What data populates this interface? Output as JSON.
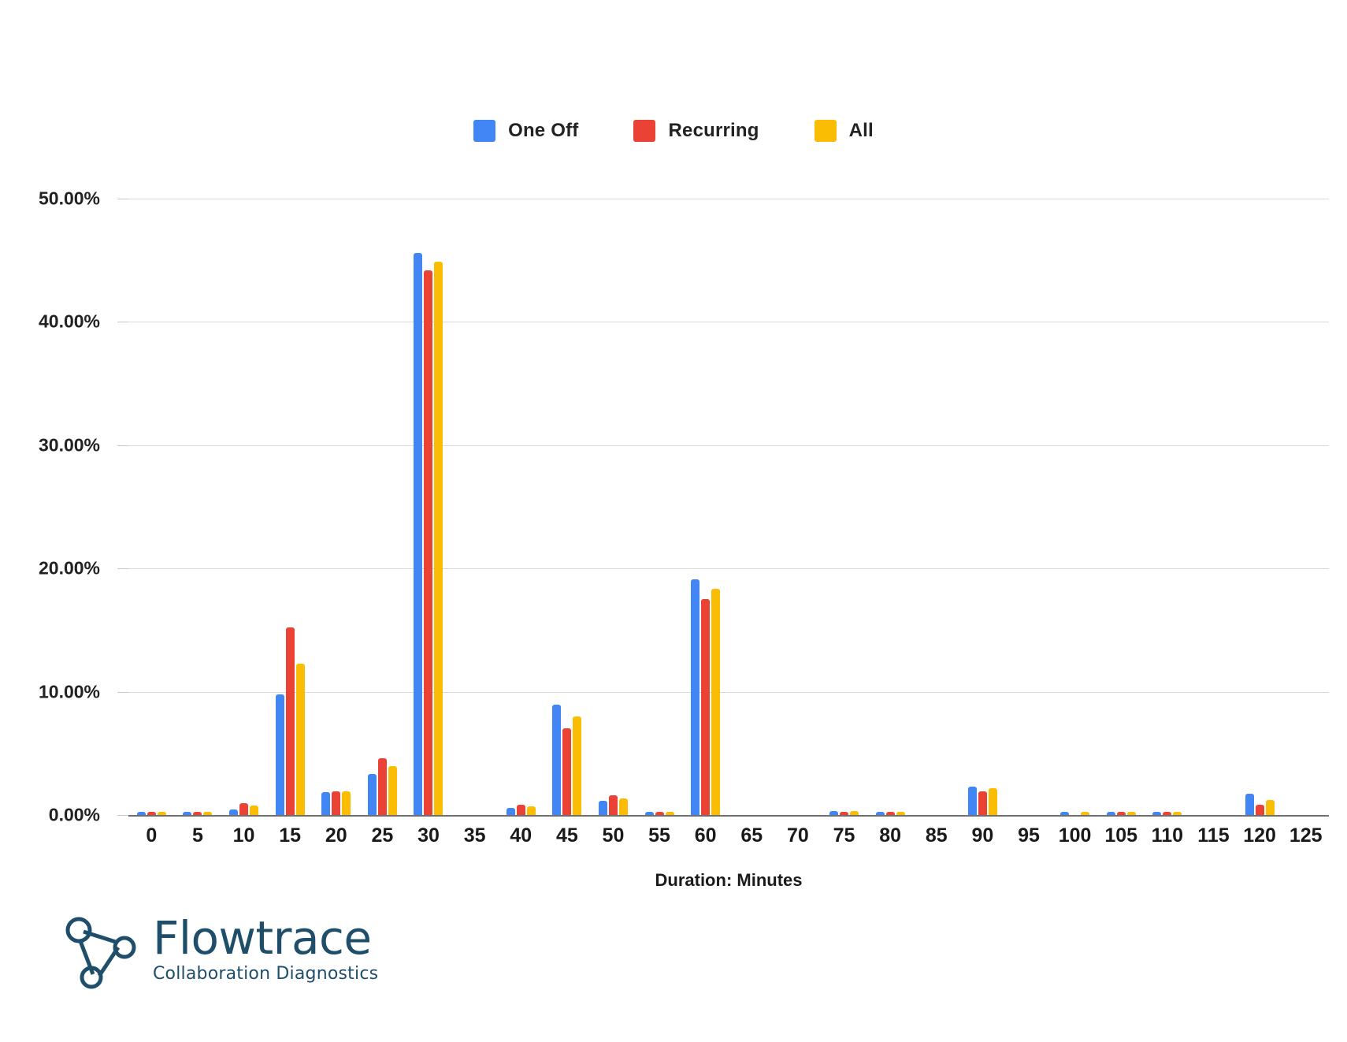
{
  "legend": {
    "position": "top-center",
    "items": [
      {
        "label": "One Off",
        "color": "#4285F4",
        "icon": "legend-swatch"
      },
      {
        "label": "Recurring",
        "color": "#EA4335",
        "icon": "legend-swatch"
      },
      {
        "label": "All",
        "color": "#FBBC04",
        "icon": "legend-swatch"
      }
    ]
  },
  "logo": {
    "name": "Flowtrace",
    "tagline": "Collaboration Diagnostics",
    "color": "#1F4E6B",
    "mark": "flowtrace-triangle-nodes-icon"
  },
  "chart_data": {
    "type": "bar",
    "title": "",
    "subtitle": "",
    "xlabel": "Duration: Minutes",
    "ylabel": "",
    "grid": true,
    "ylim": [
      0,
      50
    ],
    "ytick_labels": [
      "50.00%",
      "40.00%",
      "30.00%",
      "20.00%",
      "10.00%",
      "0.00%"
    ],
    "ytick_values": [
      50,
      40,
      30,
      20,
      10,
      0
    ],
    "categories": [
      0,
      5,
      10,
      15,
      20,
      25,
      30,
      35,
      40,
      45,
      50,
      55,
      60,
      65,
      70,
      75,
      80,
      85,
      90,
      95,
      100,
      105,
      110,
      115,
      120,
      125
    ],
    "xtick_labels": [
      "0",
      "5",
      "10",
      "15",
      "20",
      "25",
      "30",
      "35",
      "40",
      "45",
      "50",
      "55",
      "60",
      "65",
      "70",
      "75",
      "80",
      "85",
      "90",
      "95",
      "100",
      "105",
      "110",
      "115",
      "120",
      "125"
    ],
    "series": [
      {
        "name": "One Off",
        "color": "#4285F4",
        "values": [
          0.05,
          0.18,
          0.45,
          9.8,
          1.85,
          3.35,
          45.6,
          0.0,
          0.6,
          8.95,
          1.15,
          0.12,
          19.15,
          0.0,
          0.0,
          0.35,
          0.15,
          0.0,
          2.3,
          0.0,
          0.05,
          0.12,
          0.1,
          0.0,
          1.7,
          0.0
        ]
      },
      {
        "name": "Recurring",
        "color": "#EA4335",
        "values": [
          0.2,
          0.15,
          0.95,
          15.2,
          1.95,
          4.6,
          44.2,
          0.0,
          0.85,
          7.05,
          1.6,
          0.15,
          17.5,
          0.0,
          0.0,
          0.25,
          0.12,
          0.0,
          1.95,
          0.0,
          0.0,
          0.15,
          0.12,
          0.0,
          0.85,
          0.0
        ]
      },
      {
        "name": "All",
        "color": "#FBBC04",
        "values": [
          0.12,
          0.15,
          0.75,
          12.25,
          1.95,
          3.95,
          44.9,
          0.0,
          0.7,
          8.0,
          1.35,
          0.12,
          18.35,
          0.0,
          0.0,
          0.3,
          0.12,
          0.0,
          2.15,
          0.0,
          0.05,
          0.15,
          0.1,
          0.0,
          1.2,
          0.0
        ]
      }
    ]
  }
}
